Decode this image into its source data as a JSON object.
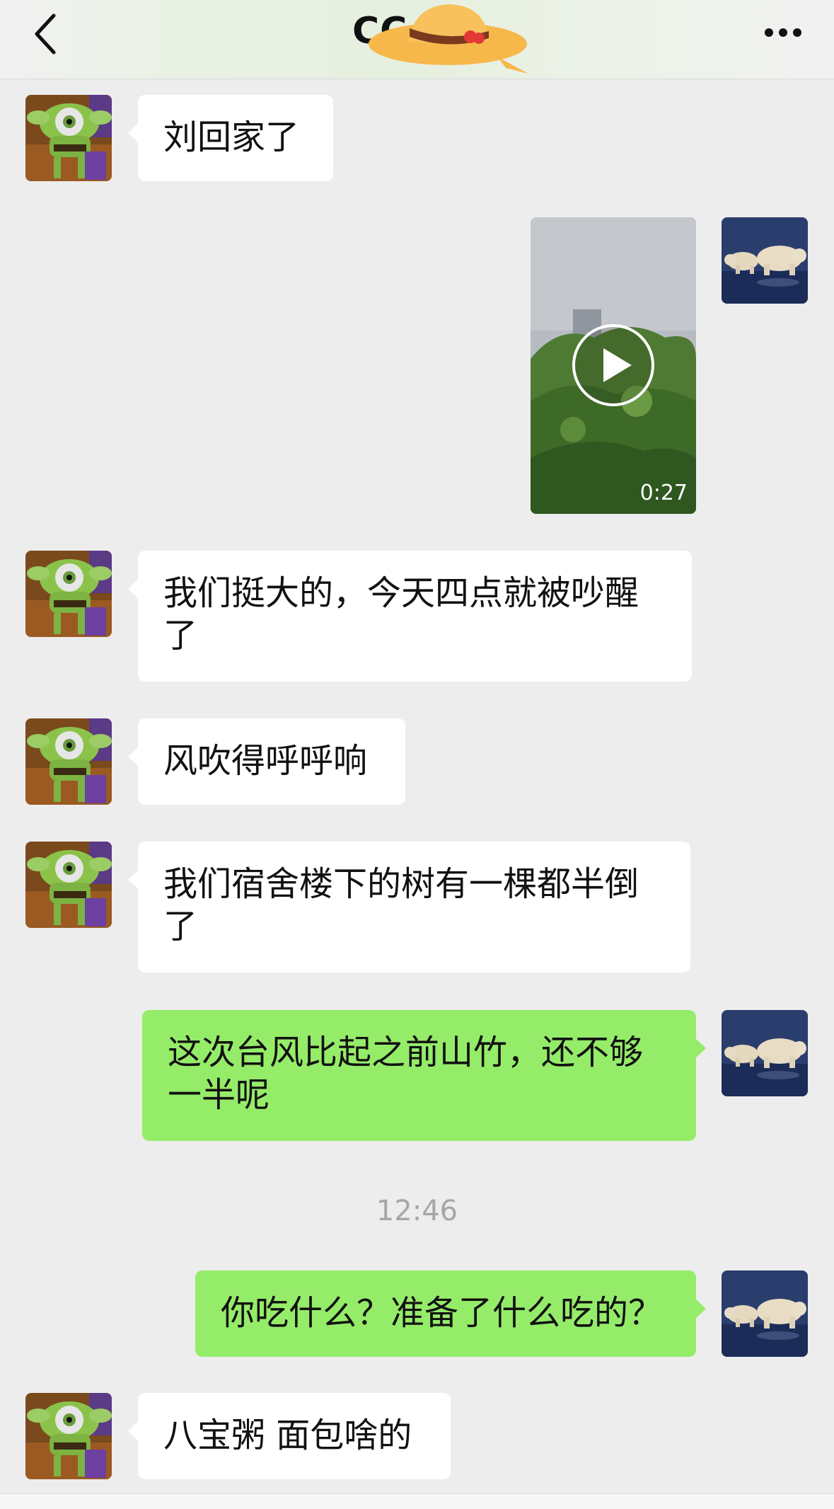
{
  "header": {
    "title": "CC",
    "back_icon": "chevron-left-icon",
    "more_icon": "ellipsis-icon"
  },
  "messages": [
    {
      "side": "left",
      "text": "刘回家了"
    },
    {
      "side": "right",
      "type": "video",
      "duration": "0:27"
    },
    {
      "side": "left",
      "text": "我们挺大的，今天四点就被吵醒了"
    },
    {
      "side": "left",
      "text": "风吹得呼呼响"
    },
    {
      "side": "left",
      "text": "我们宿舍楼下的树有一棵都半倒了"
    },
    {
      "side": "right",
      "text": "这次台风比起之前山竹，还不够一半呢"
    },
    {
      "type": "time",
      "text": "12:46"
    },
    {
      "side": "right",
      "text": "你吃什么？准备了什么吃的？"
    },
    {
      "side": "left",
      "text": "八宝粥 面包啥的"
    }
  ],
  "colors": {
    "background": "#ededed",
    "bubble_self": "#95ec69",
    "bubble_other": "#ffffff",
    "timestamp": "#a6a6a6"
  }
}
